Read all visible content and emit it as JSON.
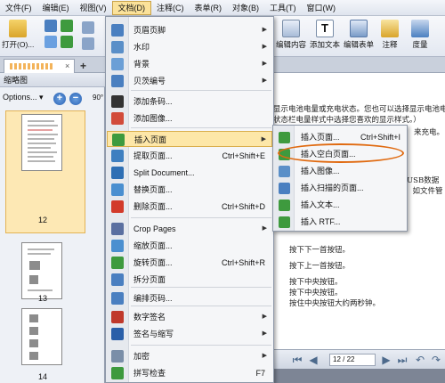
{
  "menubar": {
    "items": [
      "文件(F)",
      "编辑(E)",
      "视图(V)",
      "文档(D)",
      "注释(C)",
      "表单(R)",
      "对象(B)",
      "工具(T)",
      "窗口(W)"
    ],
    "active_index": 3
  },
  "ribbon": {
    "open_label": "打开(O)...",
    "edit_content_label": "编辑内容",
    "add_text_label": "添加文本",
    "edit_form_label": "编辑表单",
    "annotate_label": "注释",
    "measure_label": "度量"
  },
  "tabstrip": {
    "close_glyph": "×",
    "add_glyph": "+"
  },
  "panel": {
    "title": "缩略图",
    "options_label": "Options...",
    "rotate_label": "90°",
    "page_numbers": [
      "12",
      "13",
      "14"
    ]
  },
  "document": {
    "lines": [
      "显示电池电量或充电状态。您也可以选择显示电池电量",
      "状态栏电量样式中选择您喜欢的显示样式。）",
      "来充电。",
      "USB数据",
      "，如文件管",
      "按下下一首按钮。",
      "按下上一首按钮。",
      "按下中央按钮。",
      "按下中央按钮。",
      "按住中央按钮大约两秒钟。"
    ],
    "page_input": "12 / 22"
  },
  "menu": {
    "items": [
      {
        "label": "页眉页脚",
        "key": "",
        "submenu": true,
        "icon": "header-footer-icon",
        "color": "#4a7fc0"
      },
      {
        "label": "水印",
        "key": "",
        "submenu": true,
        "icon": "watermark-icon",
        "color": "#5a8fc8"
      },
      {
        "label": "背景",
        "key": "",
        "submenu": true,
        "icon": "background-icon",
        "color": "#6b9fd6"
      },
      {
        "label": "贝茨编号",
        "key": "",
        "submenu": true,
        "icon": "bates-number-icon",
        "color": "#4a7fc0"
      },
      {
        "label": "添加条码...",
        "key": "",
        "submenu": false,
        "icon": "barcode-icon",
        "color": "#333333"
      },
      {
        "label": "添加图像...",
        "key": "",
        "submenu": false,
        "icon": "image-icon",
        "color": "#d24b3a"
      },
      {
        "label": "插入页面",
        "key": "",
        "submenu": true,
        "icon": "insert-page-icon",
        "color": "#3e9a3e"
      },
      {
        "label": "提取页面...",
        "key": "Ctrl+Shift+E",
        "submenu": false,
        "icon": "extract-page-icon",
        "color": "#3e7fc0"
      },
      {
        "label": "Split Document...",
        "key": "",
        "submenu": false,
        "icon": "split-document-icon",
        "color": "#2e6fb4"
      },
      {
        "label": "替换页面...",
        "key": "",
        "submenu": false,
        "icon": "replace-page-icon",
        "color": "#4a8fd0"
      },
      {
        "label": "删除页面...",
        "key": "Ctrl+Shift+D",
        "submenu": false,
        "icon": "delete-page-icon",
        "color": "#d23a2a"
      },
      {
        "label": "Crop Pages",
        "key": "",
        "submenu": true,
        "icon": "crop-icon",
        "color": "#5a6fa0"
      },
      {
        "label": "缩放页面...",
        "key": "",
        "submenu": false,
        "icon": "resize-page-icon",
        "color": "#4a8fd0"
      },
      {
        "label": "旋转页面...",
        "key": "Ctrl+Shift+R",
        "submenu": false,
        "icon": "rotate-page-icon",
        "color": "#3e9a3e"
      },
      {
        "label": "拆分页面",
        "key": "",
        "submenu": false,
        "icon": "split-page-icon",
        "color": "#4a7fc0"
      },
      {
        "label": "编排页码...",
        "key": "",
        "submenu": false,
        "icon": "number-pages-icon",
        "color": "#4a7fc0"
      },
      {
        "label": "数字签名",
        "key": "",
        "submenu": true,
        "icon": "digital-signature-icon",
        "color": "#c0392b"
      },
      {
        "label": "签名与缩写",
        "key": "",
        "submenu": true,
        "icon": "sign-initials-icon",
        "color": "#2a5fa8"
      },
      {
        "label": "加密",
        "key": "",
        "submenu": true,
        "icon": "encrypt-icon",
        "color": "#7a8ea8"
      },
      {
        "label": "拼写检查",
        "key": "F7",
        "submenu": false,
        "icon": "spell-check-icon",
        "color": "#3e9a3e"
      }
    ]
  },
  "submenu": {
    "items": [
      {
        "label": "插入页面...",
        "key": "Ctrl+Shift+I",
        "icon": "insert-page-file-icon",
        "color": "#3e9a3e"
      },
      {
        "label": "插入空白页面...",
        "key": "",
        "icon": "insert-blank-page-icon",
        "color": "#3e9a3e"
      },
      {
        "label": "插入图像...",
        "key": "",
        "icon": "insert-image-icon",
        "color": "#5a8fc8"
      },
      {
        "label": "插入扫描的页面...",
        "key": "",
        "icon": "insert-scan-icon",
        "color": "#4a7fc0"
      },
      {
        "label": "插入文本...",
        "key": "",
        "icon": "insert-text-icon",
        "color": "#3e9a3e"
      },
      {
        "label": "插入 RTF...",
        "key": "",
        "icon": "insert-rtf-icon",
        "color": "#3e9a3e"
      }
    ],
    "circled_index": 1
  },
  "colors": {
    "highlight": "#fde7a8",
    "ring": "#e06a10",
    "menu_bg": "#f5f6f8"
  }
}
